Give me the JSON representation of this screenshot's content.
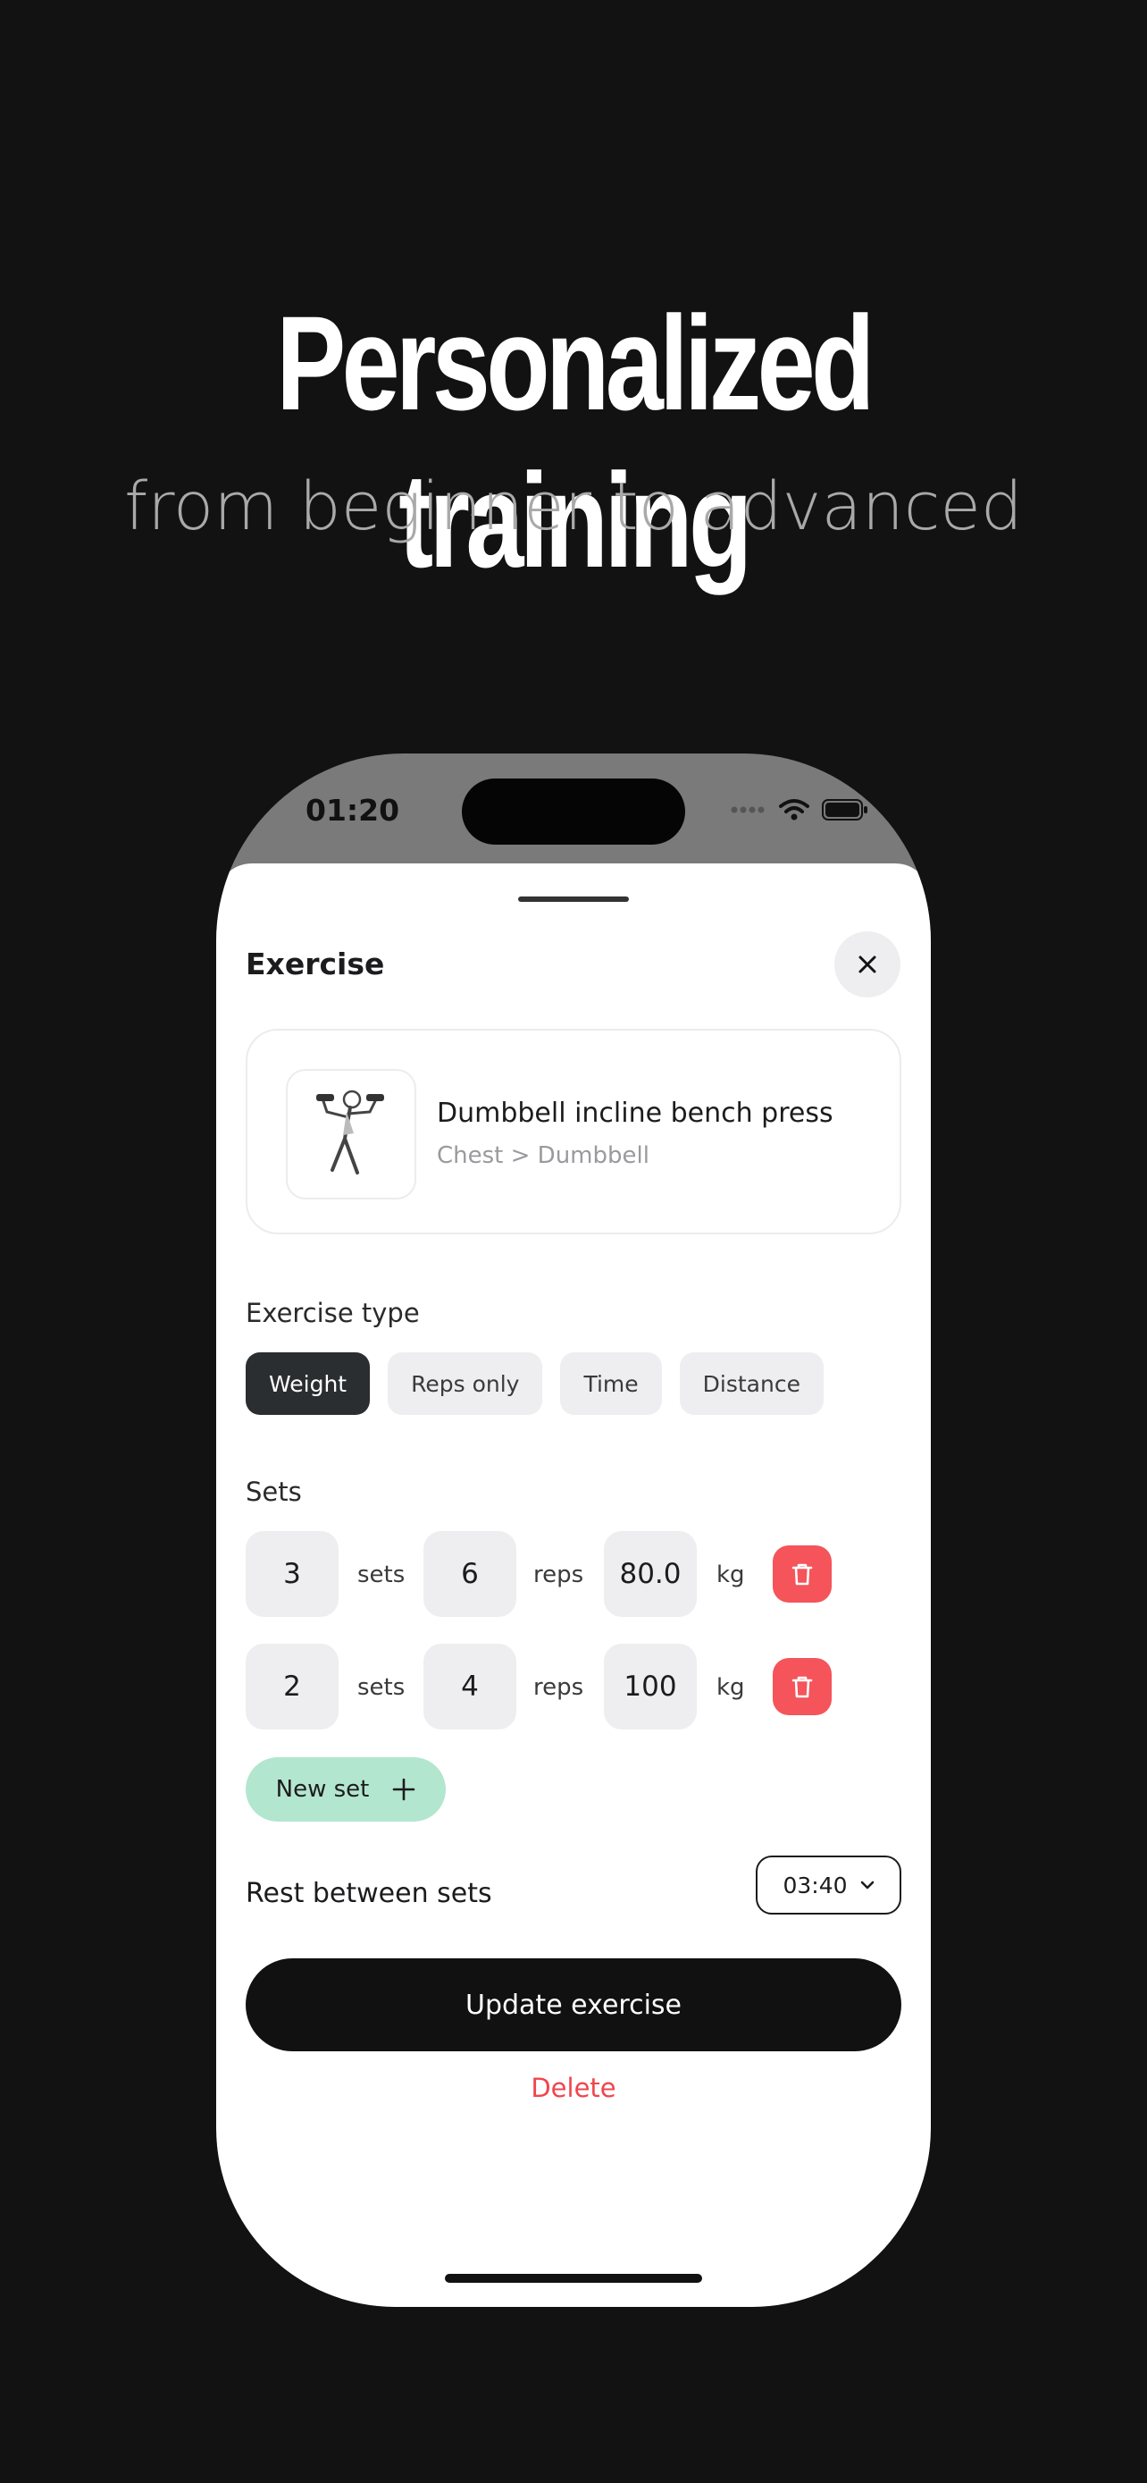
{
  "headline": {
    "title": "Personalized training",
    "subtitle": "from beginner to advanced"
  },
  "status_bar": {
    "time": "01:20",
    "icons": [
      "signal-dots-icon",
      "wifi-icon",
      "battery-icon"
    ]
  },
  "sheet": {
    "title": "Exercise",
    "close_icon": "close-icon"
  },
  "exercise": {
    "name": "Dumbbell incline bench press",
    "path": "Chest > Dumbbell"
  },
  "exercise_type": {
    "label": "Exercise type",
    "options": [
      "Weight",
      "Reps only",
      "Time",
      "Distance"
    ],
    "selected": "Weight"
  },
  "sets": {
    "label": "Sets",
    "rows": [
      {
        "sets": "3",
        "sets_unit": "sets",
        "reps": "6",
        "reps_unit": "reps",
        "weight": "80.0",
        "weight_unit": "kg"
      },
      {
        "sets": "2",
        "sets_unit": "sets",
        "reps": "4",
        "reps_unit": "reps",
        "weight": "100",
        "weight_unit": "kg"
      }
    ],
    "new_set_label": "New set"
  },
  "rest": {
    "label": "Rest between sets",
    "value": "03:40"
  },
  "actions": {
    "update_label": "Update exercise",
    "delete_label": "Delete"
  },
  "colors": {
    "accent_green": "#b3e6cf",
    "danger_red": "#f4545a",
    "primary_dark": "#111111"
  }
}
